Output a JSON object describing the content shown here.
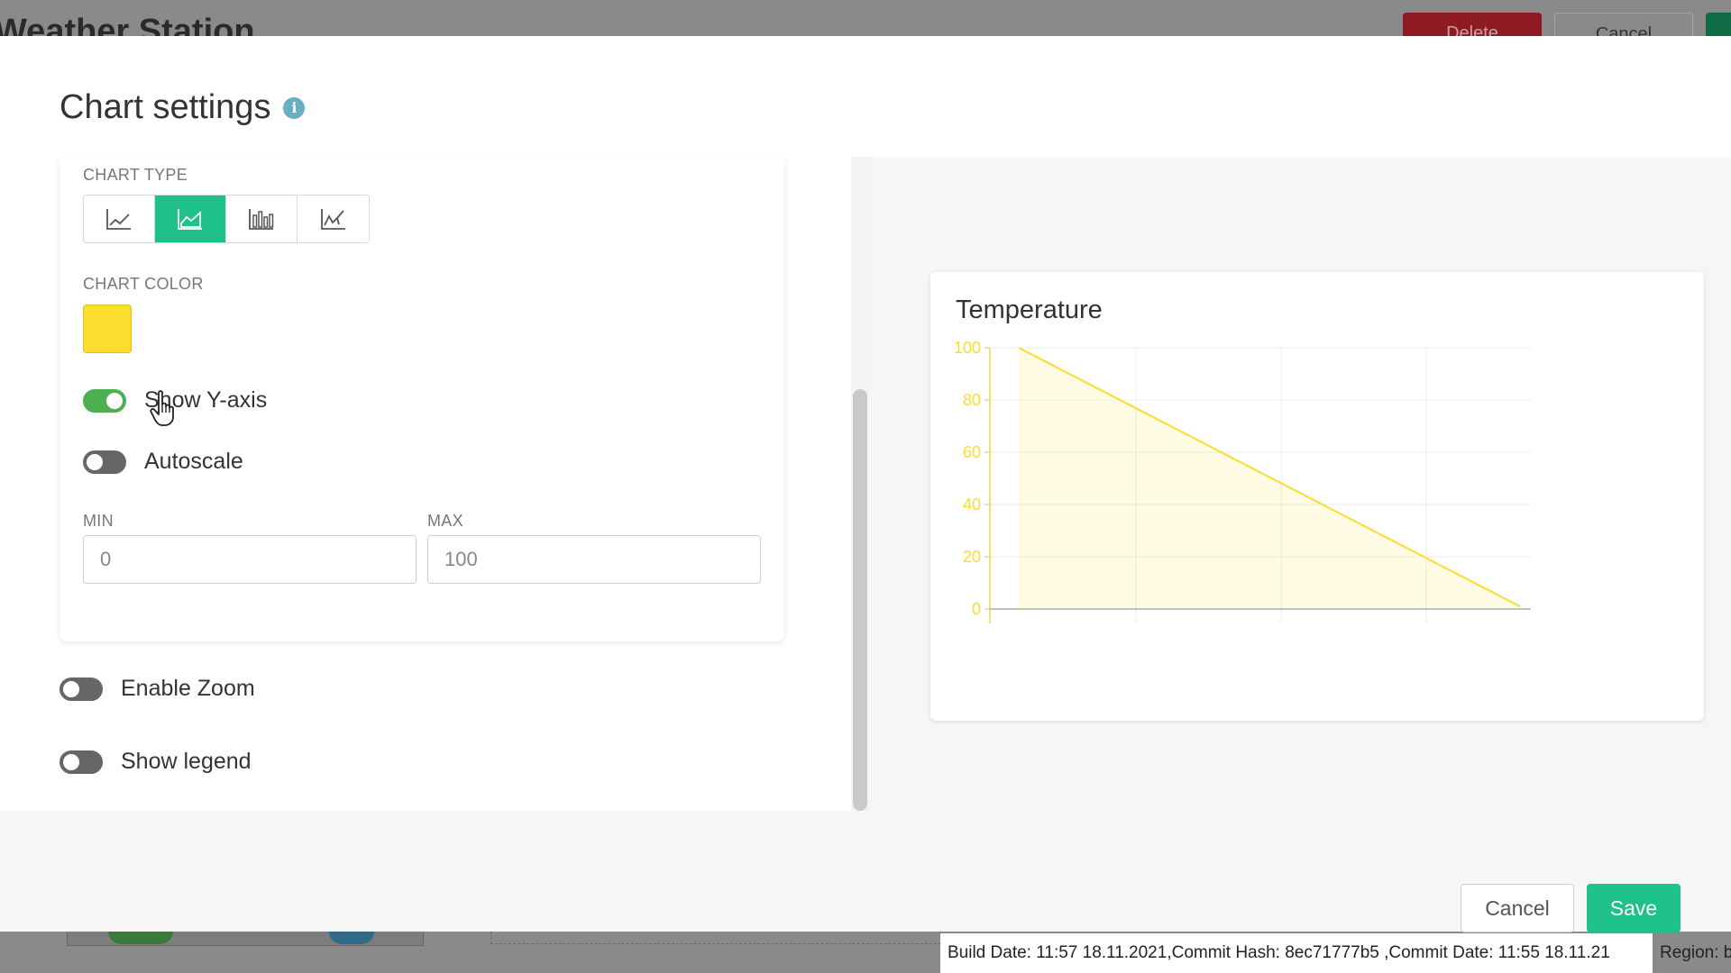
{
  "background": {
    "page_title": "Weather Station",
    "delete_label": "Delete",
    "cancel_label": "Cancel"
  },
  "modal": {
    "title": "Chart settings",
    "info_icon": "info-icon"
  },
  "settings": {
    "chart_type_label": "CHART TYPE",
    "chart_types": [
      {
        "name": "line",
        "icon": "line-chart-icon",
        "selected": false
      },
      {
        "name": "area",
        "icon": "area-chart-icon",
        "selected": true
      },
      {
        "name": "bar",
        "icon": "bar-chart-icon",
        "selected": false
      },
      {
        "name": "step",
        "icon": "step-chart-icon",
        "selected": false
      }
    ],
    "chart_color_label": "CHART COLOR",
    "chart_color": "#fcdc2c",
    "show_y_axis": {
      "label": "Show Y-axis",
      "on": true
    },
    "autoscale": {
      "label": "Autoscale",
      "on": false
    },
    "min_label": "MIN",
    "min_value": "0",
    "max_label": "MAX",
    "max_value": "100",
    "enable_zoom": {
      "label": "Enable Zoom",
      "on": false
    },
    "show_legend": {
      "label": "Show legend",
      "on": false
    }
  },
  "preview": {
    "chart_title": "Temperature"
  },
  "chart_data": {
    "type": "area",
    "title": "Temperature",
    "xlabel": "",
    "ylabel": "",
    "x": [
      0,
      1
    ],
    "values": [
      100,
      1
    ],
    "ylim": [
      0,
      100
    ],
    "yticks": [
      0,
      20,
      40,
      60,
      80,
      100
    ],
    "grid": true,
    "color": "#fcdc2c",
    "legend": "none"
  },
  "footer": {
    "cancel_label": "Cancel",
    "save_label": "Save"
  },
  "build_info": {
    "text": "Build Date: 11:57 18.11.2021,Commit Hash: 8ec71777b5 ,Commit Date: 11:55 18.11.21",
    "region_text": "Region: b"
  },
  "colors": {
    "accent": "#1ec288",
    "toggle_on": "#4caf50",
    "chart_line": "#fcdc2c"
  }
}
